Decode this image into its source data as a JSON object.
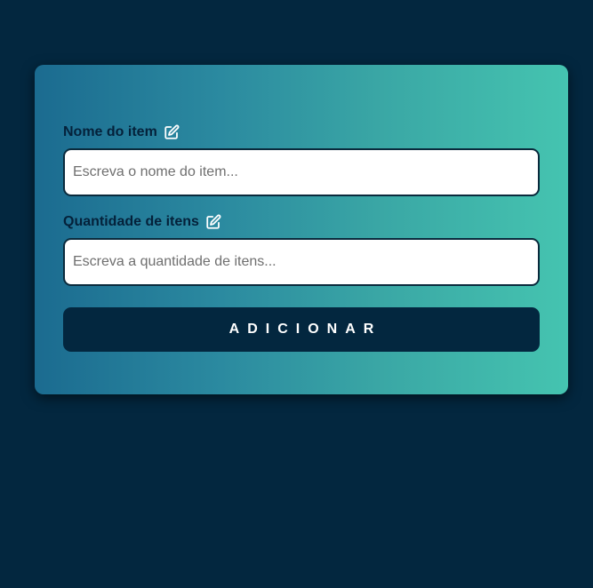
{
  "form": {
    "item_name": {
      "label": "Nome do item",
      "placeholder": "Escreva o nome do item...",
      "value": "",
      "icon": "edit-icon"
    },
    "item_quantity": {
      "label": "Quantidade de itens",
      "placeholder": "Escreva a quantidade de itens...",
      "value": "",
      "icon": "edit-icon"
    },
    "submit_label": "ADICIONAR"
  },
  "colors": {
    "background": "#03273f",
    "card_gradient_start": "#1b6b90",
    "card_gradient_end": "#45c4b0",
    "button": "#03273f",
    "label_text": "#04213a"
  }
}
